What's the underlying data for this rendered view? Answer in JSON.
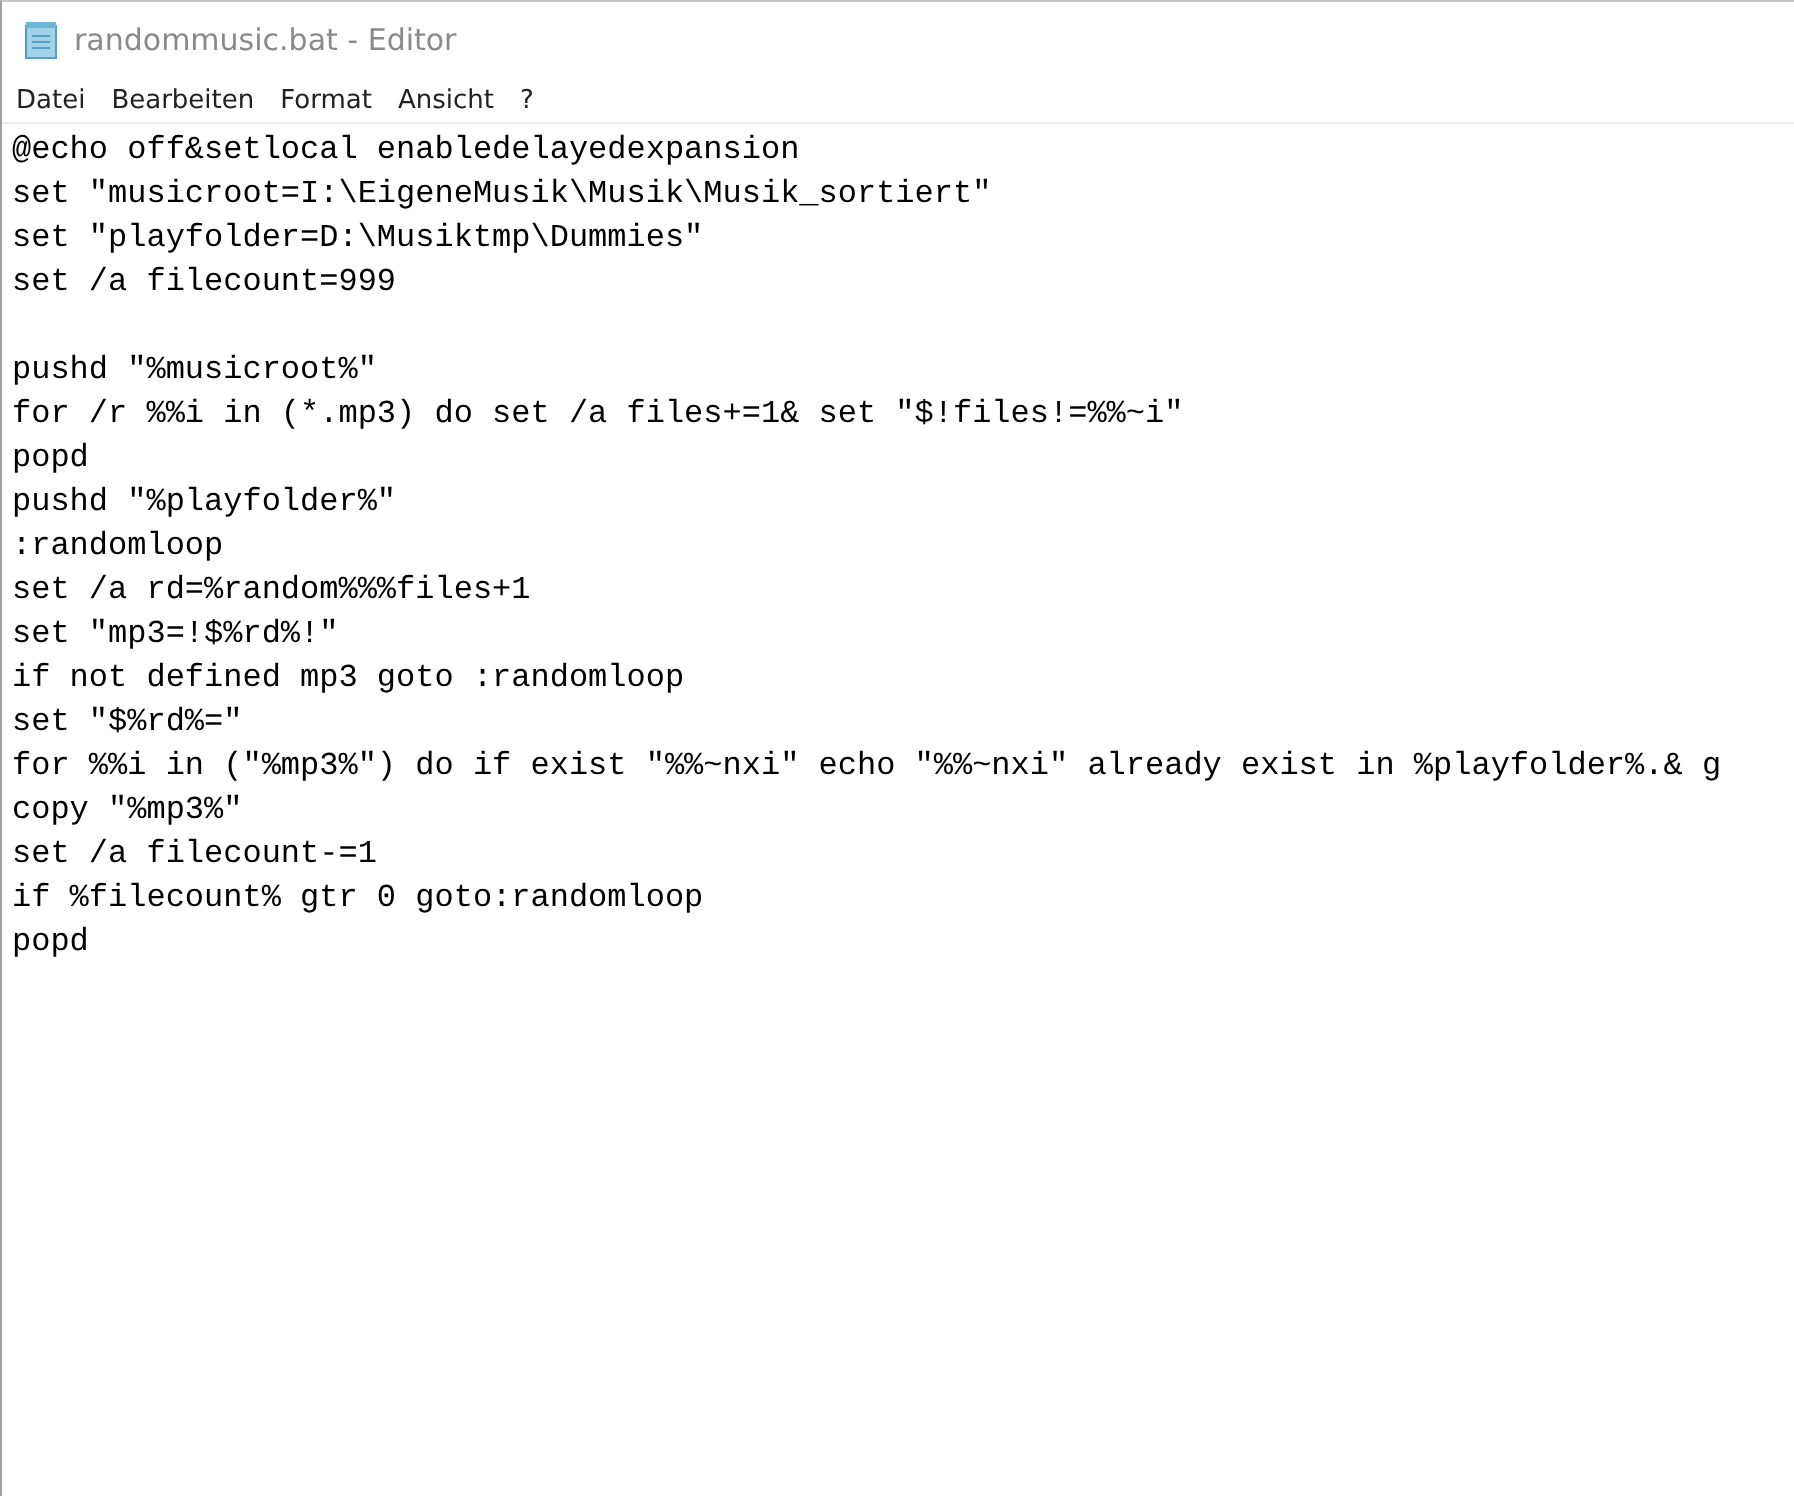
{
  "window": {
    "title": "randommusic.bat - Editor"
  },
  "menu": [
    "Datei",
    "Bearbeiten",
    "Format",
    "Ansicht",
    "?"
  ],
  "editor": {
    "blocks": [
      {
        "lines": [
          "@echo off&setlocal enabledelayedexpansion",
          "set \"musicroot=I:\\EigeneMusik\\Musik\\Musik_sortiert\"",
          "set \"playfolder=D:\\Musiktmp\\Dummies\"",
          "set /a filecount=999"
        ]
      },
      {
        "lines": [
          "pushd \"%musicroot%\"",
          "for /r %%i in (*.mp3) do set /a files+=1& set \"$!files!=%%~i\"",
          "popd",
          "pushd \"%playfolder%\"",
          ":randomloop",
          "set /a rd=%random%%%files+1",
          "set \"mp3=!$%rd%!\"",
          "if not defined mp3 goto :randomloop",
          "set \"$%rd%=\"",
          "for %%i in (\"%mp3%\") do if exist \"%%~nxi\" echo \"%%~nxi\" already exist in %playfolder%.& g",
          "copy \"%mp3%\"",
          "set /a filecount-=1",
          "if %filecount% gtr 0 goto:randomloop",
          "popd"
        ]
      }
    ]
  }
}
